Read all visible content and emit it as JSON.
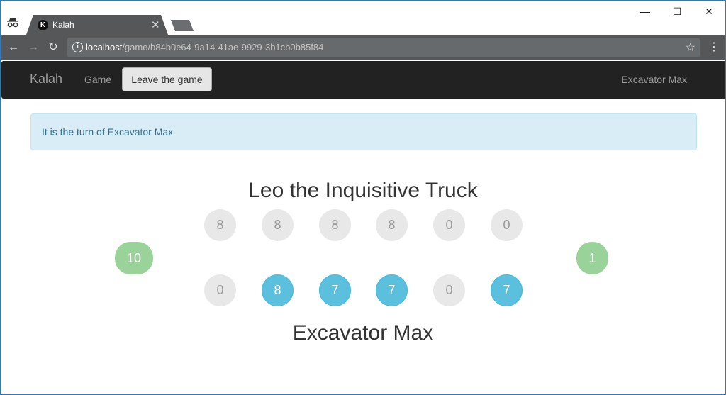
{
  "browser": {
    "tab_title": "Kalah",
    "tab_favicon_letter": "K",
    "url_host": "localhost",
    "url_path": "/game/b84b0e64-9a14-41ae-9929-3b1cb0b85f84"
  },
  "navbar": {
    "brand": "Kalah",
    "game_link": "Game",
    "leave_button": "Leave the game",
    "current_user": "Excavator Max"
  },
  "alert": {
    "message": "It is the turn of Excavator Max"
  },
  "board": {
    "top_player": {
      "name": "Leo the Inquisitive Truck",
      "pits": [
        "8",
        "8",
        "8",
        "8",
        "0",
        "0"
      ],
      "store": "10"
    },
    "bottom_player": {
      "name": "Excavator Max",
      "pits": [
        "0",
        "8",
        "7",
        "7",
        "0",
        "7"
      ],
      "pit_active": [
        false,
        true,
        true,
        true,
        false,
        true
      ],
      "store": "1"
    }
  },
  "colors": {
    "active_pit": "#5bc0de",
    "inactive_pit": "#e8e8e8",
    "store": "#9ad39a",
    "alert_bg": "#d9edf7",
    "navbar_bg": "#222222"
  }
}
